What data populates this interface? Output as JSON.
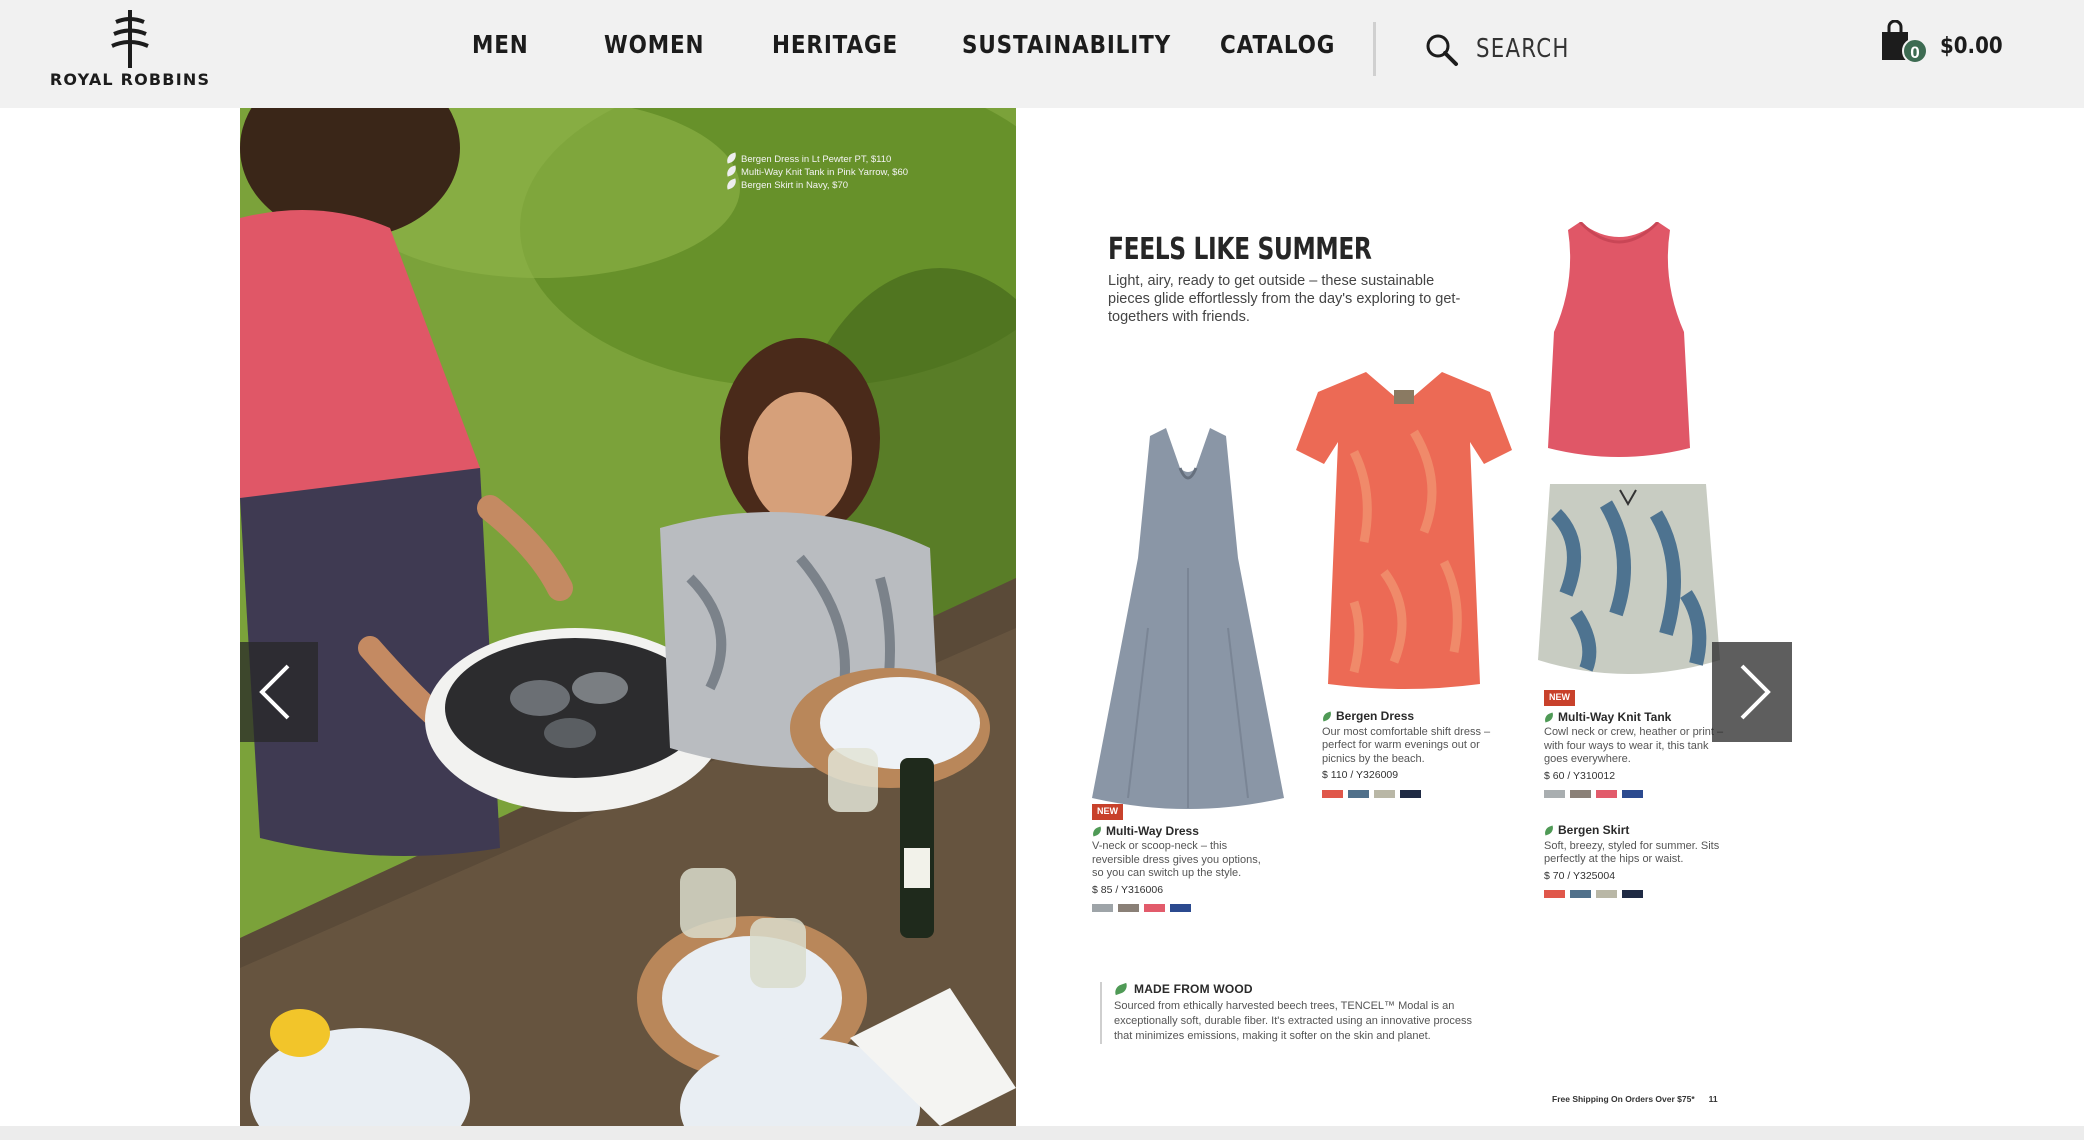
{
  "header": {
    "logo_text": "ROYAL ROBBINS",
    "logo_icon": "tree-logo-icon",
    "nav": [
      {
        "label": "MEN"
      },
      {
        "label": "WOMEN"
      },
      {
        "label": "HERITAGE"
      },
      {
        "label": "SUSTAINABILITY"
      },
      {
        "label": "CATALOG"
      }
    ],
    "search": {
      "label": "SEARCH",
      "icon": "search-icon"
    },
    "cart": {
      "count": "0",
      "total": "$0.00",
      "icon": "shopping-bag-icon"
    }
  },
  "catalog": {
    "photo_credits": [
      "Bergen Dress in Lt Pewter PT, $110",
      "Multi-Way Knit Tank in Pink Yarrow, $60",
      "Bergen Skirt in Navy, $70"
    ],
    "title": "FEELS LIKE SUMMER",
    "intro": "Light, airy, ready to get outside – these sustainable pieces glide effortlessly from the day's exploring to get-togethers with friends.",
    "products": [
      {
        "badge": "NEW",
        "name": "Multi-Way Dress",
        "description": "V-neck or scoop-neck – this reversible dress gives you options, so you can switch up the style.",
        "price": "$ 85 / Y316006",
        "swatches": [
          "#9ea4a8",
          "#8a8077",
          "#e25b6b",
          "#2b4a8f"
        ]
      },
      {
        "badge": "",
        "name": "Bergen Dress",
        "description": "Our most comfortable shift dress – perfect for warm evenings out or picnics by the beach.",
        "price": "$ 110 / Y326009",
        "swatches": [
          "#e0574a",
          "#50708a",
          "#b9b7a6",
          "#1f2a44"
        ]
      },
      {
        "badge": "NEW",
        "name": "Multi-Way Knit Tank",
        "description": "Cowl neck or crew, heather or print – with four ways to wear it, this tank goes everywhere.",
        "price": "$ 60 / Y310012",
        "swatches": [
          "#a9aeb0",
          "#8a8077",
          "#e25b6b",
          "#2b4a8f"
        ]
      },
      {
        "badge": "",
        "name": "Bergen Skirt",
        "description": "Soft, breezy, styled for summer. Sits perfectly at the hips or waist.",
        "price": "$ 70 / Y325004",
        "swatches": [
          "#e0574a",
          "#50708a",
          "#b9b7a6",
          "#1f2a44"
        ]
      }
    ],
    "wood": {
      "title": "MADE FROM WOOD",
      "text": "Sourced from ethically harvested beech trees, TENCEL™ Modal is an exceptionally soft, durable fiber. It's extracted using an innovative process that minimizes emissions, making it softer on the skin and planet."
    },
    "footer": {
      "shipping": "Free Shipping On Orders Over $75*",
      "page_number": "11"
    }
  },
  "controls": {
    "prev_icon": "chevron-left-icon",
    "next_icon": "chevron-right-icon"
  },
  "colors": {
    "header_bg": "#f1f1f1",
    "cart_badge": "#3d6b52",
    "new_badge": "#c8412b",
    "leaf": "#4f9a56"
  }
}
